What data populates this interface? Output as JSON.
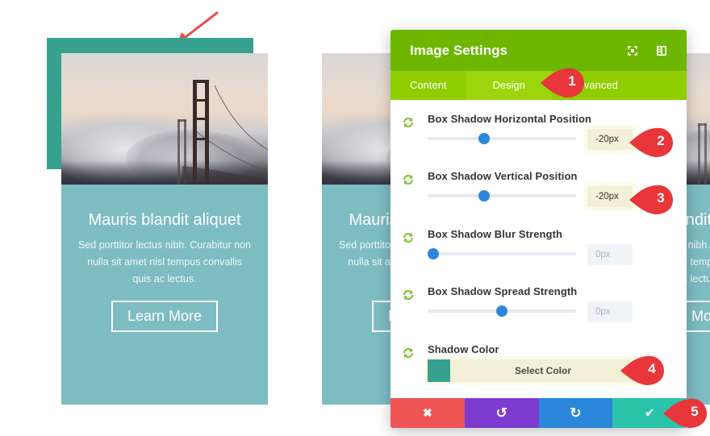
{
  "cards": [
    {
      "title": "Mauris blandit aliquet",
      "text": "Sed porttitor lectus nibh. Curabitur non nulla sit amet nisl tempus convallis quis ac lectus.",
      "button_label": "Learn More",
      "shadow_color": "#36a18f"
    },
    {
      "title": "Mauris blandit aliquet",
      "text": "Sed porttitor lectus nibh. Curabitur non nulla sit amet nisl tempus convallis quis ac lectus.",
      "button_label": "Learn More"
    },
    {
      "title": "Mauris blandit aliquet",
      "text": "Sed porttitor lectus nibh. Curabitur non nulla sit amet nisl tempus convallis quis ac lectus.",
      "button_label": "Learn More"
    }
  ],
  "modal": {
    "title": "Image Settings",
    "header_icons": [
      "fullscreen-icon",
      "split-view-icon"
    ],
    "tabs": [
      {
        "label": "Content",
        "active": false
      },
      {
        "label": "Design",
        "active": true
      },
      {
        "label": "Advanced",
        "active": false
      }
    ],
    "fields": [
      {
        "label": "Box Shadow Horizontal Position",
        "value": "-20px",
        "slider_percent": 38,
        "changed": true
      },
      {
        "label": "Box Shadow Vertical Position",
        "value": "-20px",
        "slider_percent": 38,
        "changed": true
      },
      {
        "label": "Box Shadow Blur Strength",
        "value": "0px",
        "slider_percent": 4,
        "changed": false
      },
      {
        "label": "Box Shadow Spread Strength",
        "value": "0px",
        "slider_percent": 50,
        "changed": false
      }
    ],
    "color_field": {
      "label": "Shadow Color",
      "button_label": "Select Color",
      "color": "#36a18f"
    },
    "footer": {
      "cancel_icon": "✖",
      "undo_icon": "↺",
      "redo_icon": "↻",
      "save_icon": "✔"
    }
  },
  "callouts": [
    "1",
    "2",
    "3",
    "4",
    "5"
  ],
  "colors": {
    "header": "#6db700",
    "tabs": "#8fce00",
    "slider_thumb": "#2b87da",
    "card_body": "#7dbcc2",
    "callout": "#e8363b",
    "cancel": "#ef5555",
    "undo": "#7e3bd0",
    "redo": "#2b87da",
    "save": "#29c4a9"
  }
}
